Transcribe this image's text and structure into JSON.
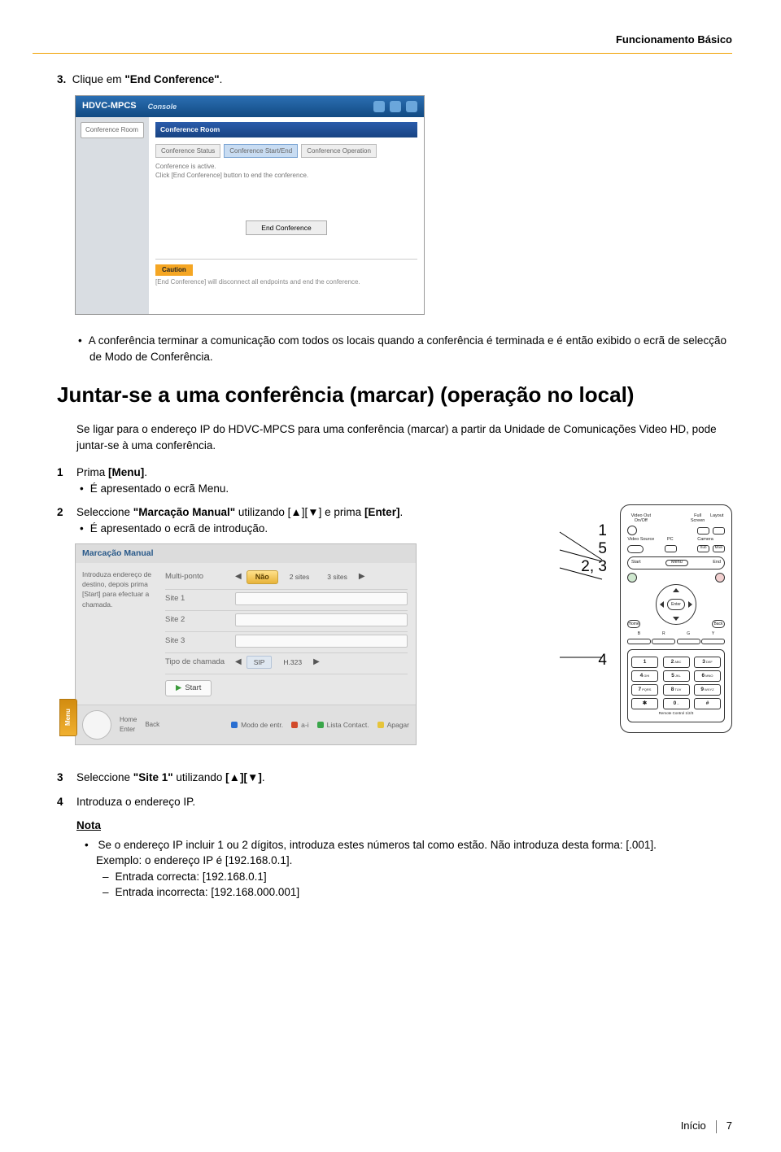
{
  "header": {
    "section": "Funcionamento Básico"
  },
  "step3": {
    "num": "3.",
    "text_a": "Clique em ",
    "text_bold": "\"End Conference\"",
    "text_b": ".",
    "bullet": "A conferência terminar a comunicação com todos os locais quando a conferência é terminada e é então exibido o ecrã de selecção de Modo de Conferência."
  },
  "sc_top": {
    "title": "HDVC-MPCS",
    "console": "Console",
    "icon1": "Home",
    "icon2": "Settings",
    "icon3": "Maintenance",
    "left_tab": "Conference Room",
    "bluebar": "Conference Room",
    "tab1": "Conference Status",
    "tab2": "Conference Start/End",
    "tab3": "Conference Operation",
    "line1": "Conference is active.",
    "line2": "Click [End Conference] button to end the conference.",
    "end_btn": "End Conference",
    "caution_lbl": "Caution",
    "caution_txt": "[End Conference] will disconnect all endpoints and end the conference."
  },
  "h2": "Juntar-se a uma conferência (marcar) (operação no local)",
  "intro": "Se ligar para o endereço IP do HDVC-MPCS para uma conferência (marcar) a partir da Unidade de Comunicações Video HD, pode juntar-se à uma conferência.",
  "s1": {
    "n": "1",
    "t1": "Prima ",
    "t1b": "[Menu]",
    "t1c": ".",
    "b1": "É apresentado o ecrã Menu."
  },
  "s2": {
    "n": "2",
    "t1": "Seleccione ",
    "t1b": "\"Marcação Manual\"",
    "t1c": " utilizando  [▲][▼] e prima ",
    "t1d": "[Enter]",
    "t1e": ".",
    "b1": "É apresentado o ecrã de introdução."
  },
  "callouts": {
    "l1": "1",
    "l2": "5",
    "l3": "2, 3",
    "l4": "4"
  },
  "remote": {
    "lbl_video_out": "Video Out",
    "lbl_onoff": "On/Off",
    "lbl_fullscreen": "Full Screen",
    "lbl_layout": "Layout",
    "lbl_pc": "PC",
    "lbl_camera": "Camera",
    "lbl_video_src": "Video Source",
    "lbl_sub": "Sub",
    "lbl_main": "Main",
    "lbl_start": "Start",
    "lbl_menu": "Menu",
    "lbl_end": "End",
    "lbl_enter": "Enter",
    "lbl_home": "Home",
    "lbl_back": "Back",
    "lbl_b": "B",
    "lbl_r": "R",
    "lbl_g": "G",
    "lbl_y": "Y",
    "k1": "1",
    "k2": "2",
    "k2s": "ABC",
    "k3": "3",
    "k3s": "DEF",
    "k4": "4",
    "k4s": "GHI",
    "k5": "5",
    "k5s": "JKL",
    "k6": "6",
    "k6s": "MNO",
    "k7": "7",
    "k7s": "PQRS",
    "k8": "8",
    "k8s": "TUV",
    "k9": "9",
    "k9s": "WXYZ",
    "k10": "✱",
    "k11": "0",
    "k11s": "–",
    "k12": "#",
    "kp_foot": "Remote Control 1/2/3"
  },
  "mm": {
    "title": "Marcação Manual",
    "left_text": "Introduza endereço de destino, depois prima [Start] para efectuar a chamada.",
    "r_multi_lbl": "Multi-ponto",
    "r_multi_val": "Não",
    "r_multi_2": "2 sites",
    "r_multi_3": "3 sites",
    "r_s1": "Site 1",
    "r_s2": "Site 2",
    "r_s3": "Site 3",
    "r_type": "Tipo de chamada",
    "r_sip": "SIP",
    "r_h323": "H.323",
    "start_btn": "Start",
    "flag": "Menu",
    "f_home": "Home",
    "f_back": "Back",
    "f_enter": "Enter",
    "f_blue": "Modo de entr.",
    "f_red": "a-i",
    "f_green": "Lista Contact.",
    "f_yellow": "Apagar"
  },
  "s3": {
    "n": "3",
    "t1": "Seleccione ",
    "t1b": "\"Site 1\"",
    "t1c": " utilizando ",
    "t1d": "[▲][▼]",
    "t1e": "."
  },
  "s4": {
    "n": "4",
    "t1": "Introduza o endereço IP."
  },
  "nota": {
    "label": "Nota",
    "b1a": "Se o endereço IP incluir 1 ou 2 dígitos, introduza estes números tal como estão. Não introduza desta forma: [.001].",
    "b1b": "Exemplo: o endereço IP é [192.168.0.1].",
    "d1": "Entrada correcta: [192.168.0.1]",
    "d2": "Entrada incorrecta: [192.168.000.001]"
  },
  "footer": {
    "label": "Início",
    "page": "7"
  }
}
